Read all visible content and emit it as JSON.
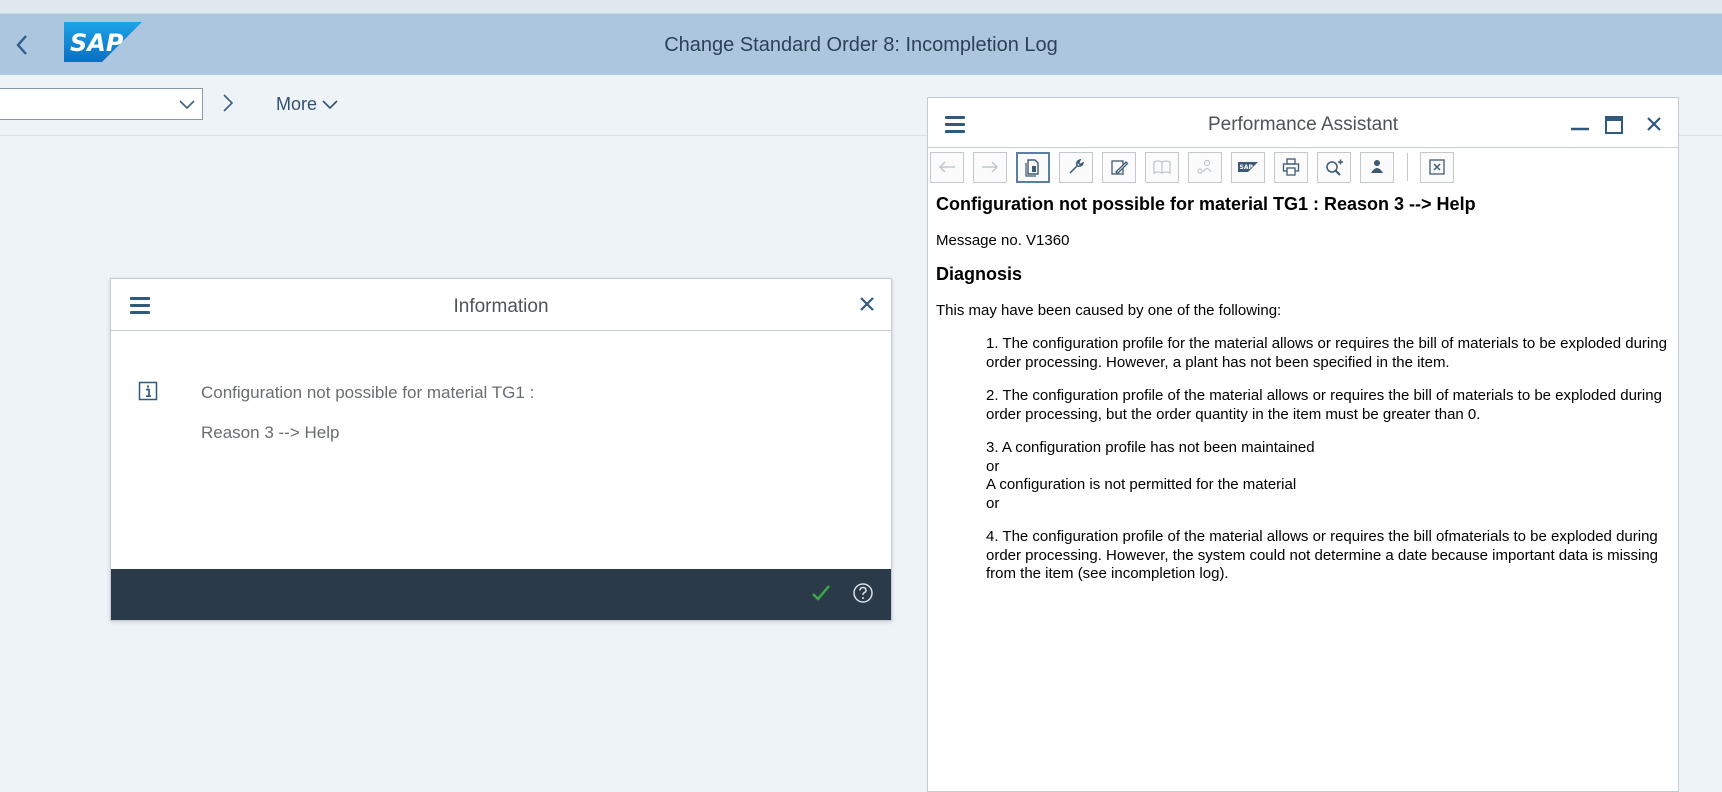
{
  "shell": {
    "title": "Change Standard Order 8: Incompletion Log",
    "logo_text": "SAP"
  },
  "toolbar": {
    "dropdown_value": "",
    "more_label": "More"
  },
  "info_dialog": {
    "title": "Information",
    "message_line1": "Configuration not possible for material TG1 :",
    "message_line2": "Reason 3 --> Help"
  },
  "performance_assistant": {
    "title": "Performance Assistant",
    "heading": "Configuration not possible for material TG1 : Reason 3 --> Help",
    "message_no": "Message no. V1360",
    "diagnosis_heading": "Diagnosis",
    "intro": "This may have been caused by one of the following:",
    "items": [
      "1. The configuration profile for the material allows or requires the bill of materials to be exploded during order processing. However, a plant has not been specified in the item.",
      "2. The configuration profile of the material allows or requires the bill of materials to be exploded during order processing, but the order quantity in the item must be greater than 0.",
      "4. The configuration profile of the material allows or requires the bill ofmaterials to be exploded during order processing. However, the system could not determine a date because important data is missing from the item (see incompletion log)."
    ],
    "item3_lines": [
      "3. A configuration profile has not been maintained",
      "or",
      "A configuration is not permitted for the material",
      "or"
    ],
    "toolbar_icons": [
      "back-arrow-icon",
      "forward-arrow-icon",
      "document-icon",
      "wrench-icon",
      "edit-icon",
      "book-icon",
      "people-icon",
      "sap-icon",
      "print-icon",
      "zoom-in-icon",
      "user-icon",
      "close-box-icon"
    ]
  },
  "colors": {
    "shell_bar": "#abc6de",
    "background": "#eef3f8",
    "dialog_footer": "#2b3a48",
    "icon_blue": "#30597f",
    "ok_green": "#2e9b3e"
  }
}
